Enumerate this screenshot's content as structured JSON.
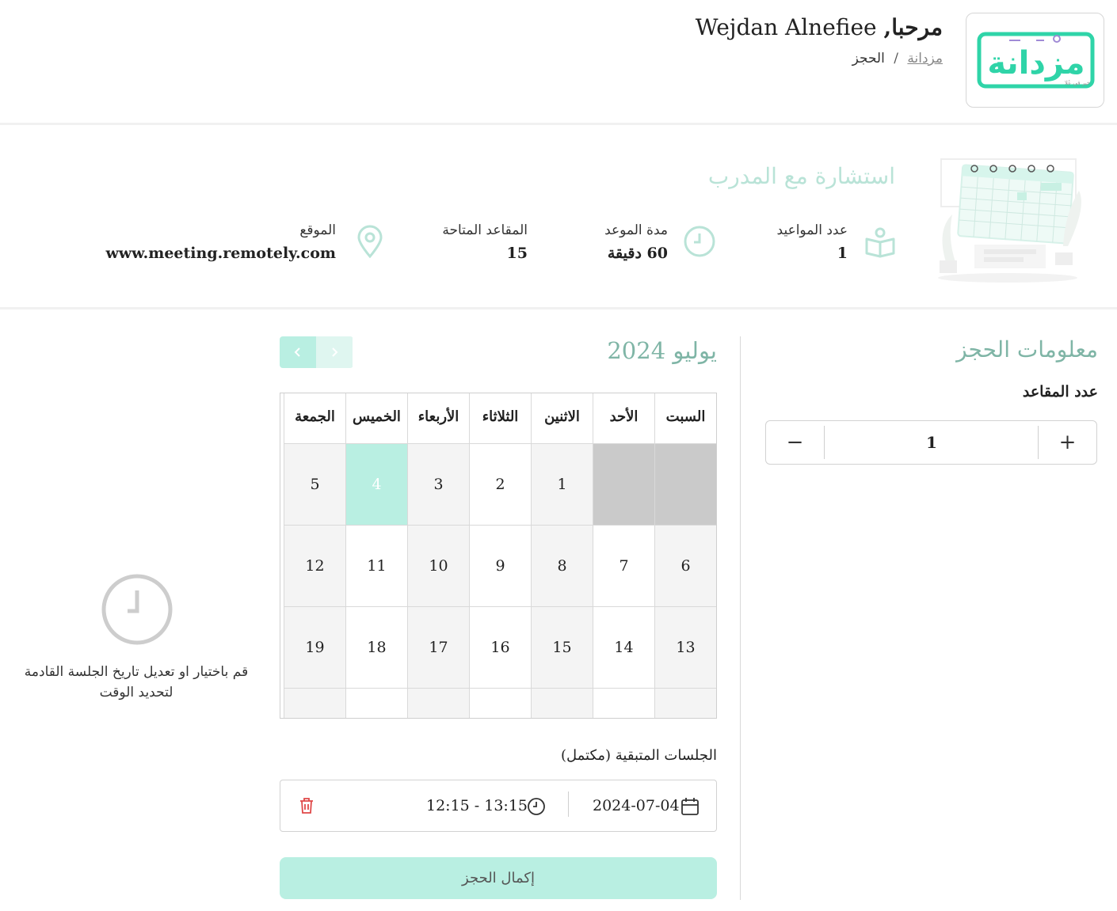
{
  "header": {
    "greeting": "مرحبا,",
    "user_name": "Wejdan Alnefiee",
    "breadcrumb": {
      "home": "مزدانة",
      "separator": "/",
      "current": "الحجز"
    },
    "logo_text": "مزدانة",
    "logo_tagline": "خير في عُلا"
  },
  "service": {
    "title": "استشارة مع المدرب",
    "stats": {
      "appointments": {
        "label": "عدد المواعيد",
        "value": "1",
        "icon": "book-icon"
      },
      "duration": {
        "label": "مدة الموعد",
        "value": "60 دقيقة",
        "icon": "clock-icon"
      },
      "seats": {
        "label": "المقاعد المتاحة",
        "value": "15"
      },
      "location": {
        "label": "الموقع",
        "value": "www.meeting.remotely.com",
        "icon": "location-pin-icon"
      }
    }
  },
  "booking": {
    "title": "معلومات الحجز",
    "seats_label": "عدد المقاعد",
    "seats_value": "1",
    "plus": "+",
    "minus": "−"
  },
  "calendar": {
    "month_label": "يوليو 2024",
    "weekdays": [
      "السبت",
      "الأحد",
      "الاثنين",
      "الثلاثاء",
      "الأربعاء",
      "الخميس",
      "الجمعة"
    ],
    "weeks": [
      [
        "",
        "",
        "1",
        "2",
        "3",
        "4",
        "5"
      ],
      [
        "6",
        "7",
        "8",
        "9",
        "10",
        "11",
        "12"
      ],
      [
        "13",
        "14",
        "15",
        "16",
        "17",
        "18",
        "19"
      ],
      [
        "",
        "",
        "",
        "",
        "",
        "",
        ""
      ]
    ],
    "selected_day": "4"
  },
  "sessions": {
    "label": "الجلسات المتبقية (مكتمل)",
    "items": [
      {
        "date": "2024-07-04",
        "time": "12:15 - 13:15"
      }
    ]
  },
  "submit_label": "إكمال الحجز",
  "time_placeholder": "قم باختيار او تعديل تاريخ الجلسة القادمة لتحديد الوقت",
  "colors": {
    "accent": "#b9efe2",
    "accent_text": "#7fb5a6",
    "logo": "#2fd4a8",
    "danger": "#e04848"
  }
}
